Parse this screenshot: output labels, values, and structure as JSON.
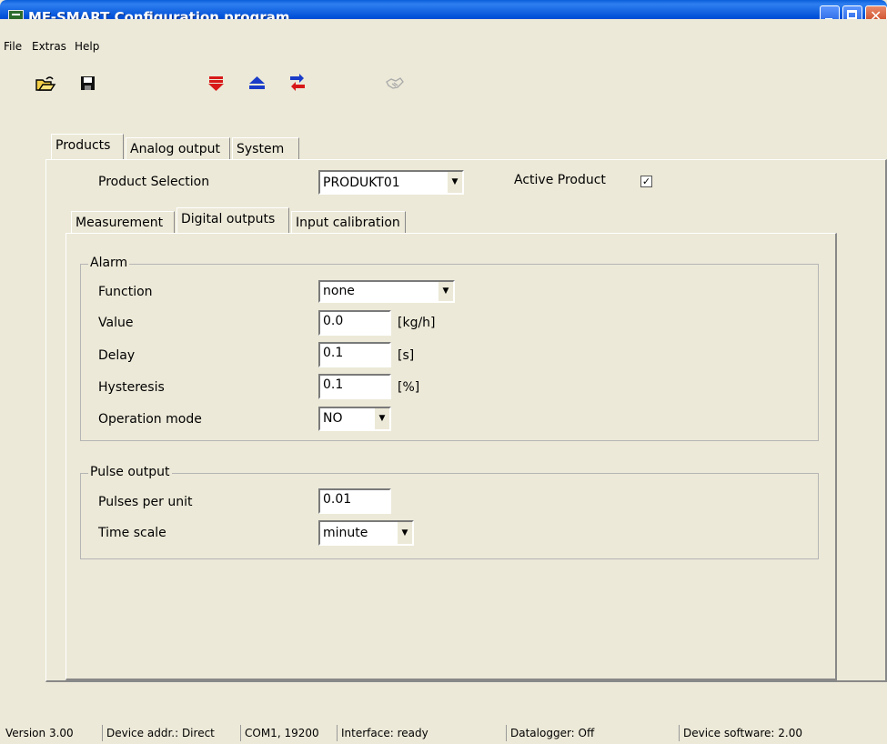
{
  "window": {
    "title": "MF-SMART Configuration program"
  },
  "menu": [
    "File",
    "Extras",
    "Help"
  ],
  "toolbar": {
    "icons": [
      "open-folder-icon",
      "save-floppy-icon",
      "download-arrow-icon",
      "eject-upload-icon",
      "swap-arrows-icon",
      "handshake-icon"
    ]
  },
  "top_tabs": {
    "selected": "Products",
    "products": {
      "label": "Products"
    },
    "analog": {
      "label": "Analog output"
    },
    "system": {
      "label": "System"
    }
  },
  "product_selection": {
    "label": "Product Selection",
    "value": "PRODUKT01"
  },
  "active_product": {
    "label": "Active Product",
    "checked": true,
    "mark": "✓"
  },
  "sub_tabs": {
    "selected": "Digital outputs",
    "measurement": {
      "label": "Measurement"
    },
    "digital": {
      "label": "Digital outputs"
    },
    "input_cal": {
      "label": "Input calibration"
    }
  },
  "alarm": {
    "title": "Alarm",
    "function": {
      "label": "Function",
      "value": "none"
    },
    "value": {
      "label": "Value",
      "value": "0.0",
      "unit": "[kg/h]"
    },
    "delay": {
      "label": "Delay",
      "value": "0.1",
      "unit": "[s]"
    },
    "hysteresis": {
      "label": "Hysteresis",
      "value": "0.1",
      "unit": "[%]"
    },
    "operation_mode": {
      "label": "Operation mode",
      "value": "NO"
    }
  },
  "pulse": {
    "title": "Pulse output",
    "pulses_per_unit": {
      "label": "Pulses per unit",
      "value": "0.01"
    },
    "time_scale": {
      "label": "Time scale",
      "value": "minute"
    }
  },
  "status": {
    "version": "Version 3.00",
    "device_addr": "Device addr.: Direct",
    "com": "COM1, 19200",
    "interface": "Interface: ready",
    "datalogger": "Datalogger: Off",
    "device_software": "Device software: 2.00"
  }
}
